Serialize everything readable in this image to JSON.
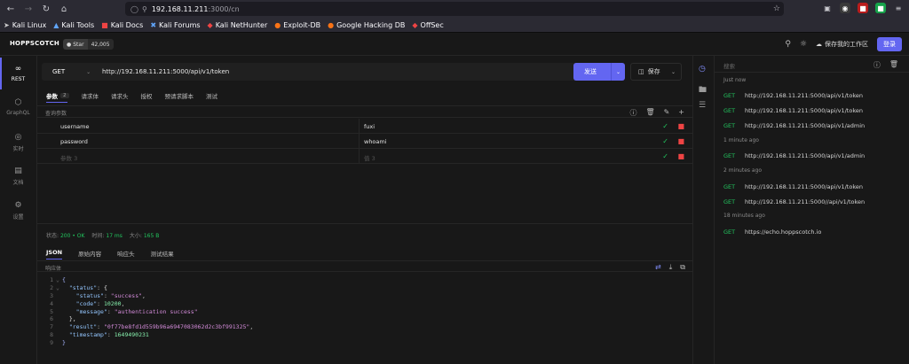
{
  "browser": {
    "url_host": "192.168.11.211",
    "url_path": ":3000/cn",
    "bookmarks": [
      "Kali Linux",
      "Kali Tools",
      "Kali Docs",
      "Kali Forums",
      "Kali NetHunter",
      "Exploit-DB",
      "Google Hacking DB",
      "OffSec"
    ]
  },
  "header": {
    "brand": "HOPPSCOTCH",
    "star_label": "Star",
    "star_count": "42,005",
    "save_workspace": "保存我的工作区",
    "login": "登录"
  },
  "rail": {
    "items": [
      "REST",
      "GraphQL",
      "实时",
      "文档",
      "设置"
    ]
  },
  "request": {
    "method": "GET",
    "url": "http://192.168.11.211:5000/api/v1/token",
    "send": "发送",
    "save": "保存",
    "tabs": [
      "参数",
      "请求体",
      "请求头",
      "授权",
      "预请求脚本",
      "测试"
    ],
    "params_count": "2",
    "params_title": "查询参数",
    "params": [
      {
        "key": "username",
        "value": "fuxi"
      },
      {
        "key": "password",
        "value": "whoami"
      }
    ],
    "param_placeholder_key": "参数 3",
    "param_placeholder_value": "值 3"
  },
  "response": {
    "status_label": "状态:",
    "status_value": "200 • OK",
    "time_label": "时间:",
    "time_value": "17 ms",
    "size_label": "大小:",
    "size_value": "165 B",
    "tabs": [
      "JSON",
      "原始内容",
      "响应头",
      "测试结果"
    ],
    "body_label": "响应体",
    "code": {
      "status_key": "\"status\"",
      "inner_status_key": "\"status\"",
      "inner_status_val": "\"success\"",
      "code_key": "\"code\"",
      "code_val": "10200",
      "message_key": "\"message\"",
      "message_val": "\"authentication success\"",
      "result_key": "\"result\"",
      "result_val": "\"0f77be8fd1d559b96a6947083062d2c3bf991325\"",
      "timestamp_key": "\"timestamp\"",
      "timestamp_val": "1649490231"
    }
  },
  "history": {
    "search_placeholder": "搜索",
    "groups": [
      {
        "label": "Just now",
        "items": [
          {
            "method": "GET",
            "url": "http://192.168.11.211:5000/api/v1/token"
          },
          {
            "method": "GET",
            "url": "http://192.168.11.211:5000/api/v1/token"
          },
          {
            "method": "GET",
            "url": "http://192.168.11.211:5000/api/v1/admin"
          }
        ]
      },
      {
        "label": "1 minute ago",
        "items": [
          {
            "method": "GET",
            "url": "http://192.168.11.211:5000/api/v1/admin"
          }
        ]
      },
      {
        "label": "2 minutes ago",
        "items": [
          {
            "method": "GET",
            "url": "http://192.168.11.211:5000/api/v1/token"
          },
          {
            "method": "GET",
            "url": "http://192.168.11.211:5000//api/v1/token"
          }
        ]
      },
      {
        "label": "18 minutes ago",
        "items": [
          {
            "method": "GET",
            "url": "https://echo.hoppscotch.io"
          }
        ]
      }
    ]
  },
  "colors": {
    "accent": "#6366f1",
    "success": "#22c55e",
    "danger": "#ef4444",
    "background": "#181818"
  }
}
